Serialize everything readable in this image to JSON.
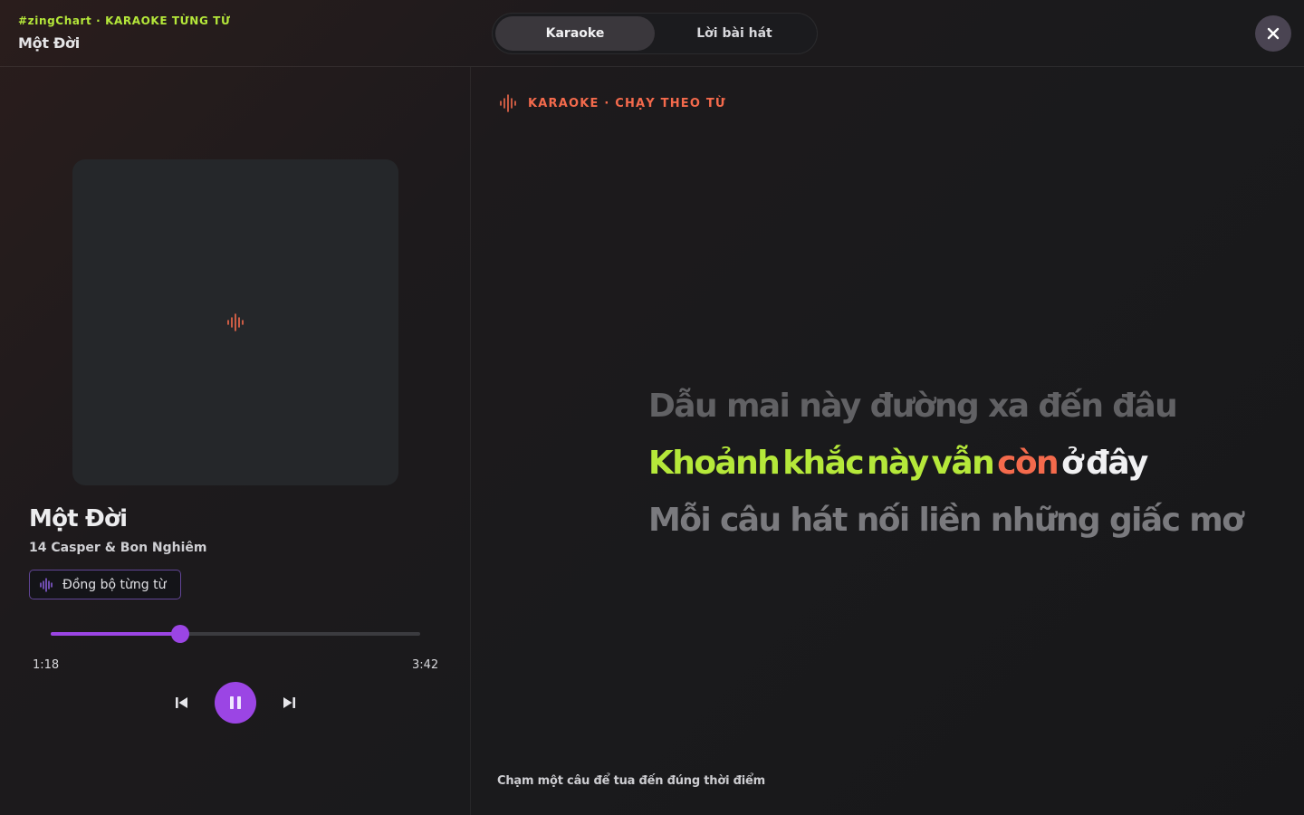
{
  "header": {
    "brand_line": "#zingChart · KARAOKE TỪNG TỪ",
    "title": "Một Đời",
    "tabs": [
      {
        "label": "Karaoke",
        "active": true
      },
      {
        "label": "Lời bài hát",
        "active": false
      }
    ],
    "close_icon": "close-icon"
  },
  "player": {
    "cover_icon": "audio-wave-icon",
    "song_title": "Một Đời",
    "artist": "14 Casper & Bon Nghiêm",
    "sync_badge": "Đồng bộ từng từ",
    "progress_fraction": 0.351,
    "current_time": "1:18",
    "total_time": "3:42",
    "controls": [
      "previous-icon",
      "pause-icon",
      "next-icon"
    ]
  },
  "karaoke": {
    "mode_label": "KARAOKE · CHẠY THEO TỪ",
    "previous_line": "Dẫu mai này đường xa đến đâu",
    "current_line": {
      "words": [
        {
          "text": "Khoảnh",
          "state": "sung"
        },
        {
          "text": "khắc",
          "state": "sung"
        },
        {
          "text": "này",
          "state": "sung"
        },
        {
          "text": "vẫn",
          "state": "sung"
        },
        {
          "text": "còn",
          "state": "active"
        },
        {
          "text": "ở",
          "state": "upcoming"
        },
        {
          "text": "đây",
          "state": "upcoming"
        }
      ]
    },
    "next_line": "Mỗi câu hát nối liền những giấc mơ",
    "hint": "Chạm một câu để tua đến đúng thời điểm"
  },
  "colors": {
    "accent_green": "#b5e83a",
    "accent_orange": "#f46a4c",
    "accent_purple": "#9b45e4"
  }
}
